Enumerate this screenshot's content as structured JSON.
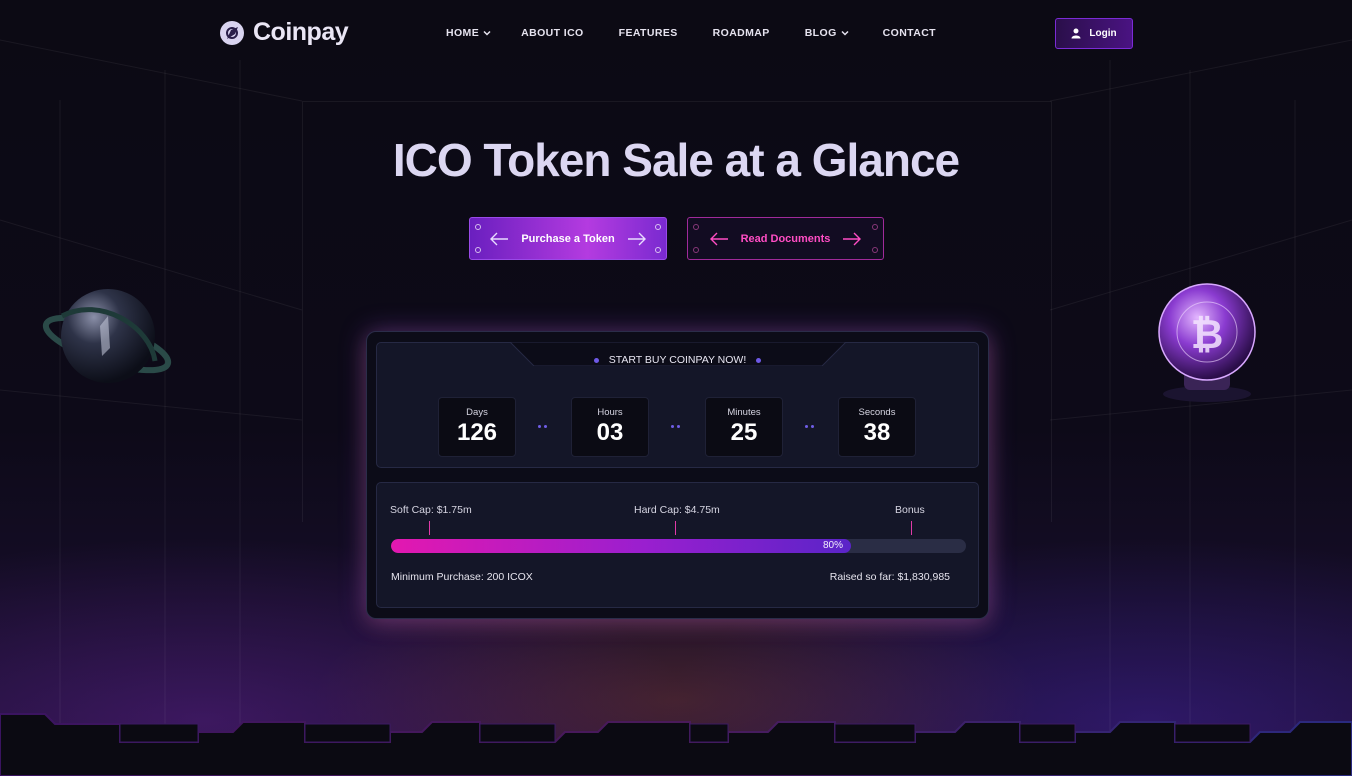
{
  "brand": {
    "name": "Coinpay"
  },
  "nav": {
    "items": [
      {
        "label": "HOME",
        "dropdown": true
      },
      {
        "label": "ABOUT ICO",
        "dropdown": false
      },
      {
        "label": "FEATURES",
        "dropdown": false
      },
      {
        "label": "ROADMAP",
        "dropdown": false
      },
      {
        "label": "BLOG",
        "dropdown": true
      },
      {
        "label": "CONTACT",
        "dropdown": false
      }
    ],
    "login_label": "Login"
  },
  "hero": {
    "title": "ICO Token Sale at a Glance",
    "primary_button": "Purchase a Token",
    "secondary_button": "Read Documents"
  },
  "sale": {
    "tab_label": "START BUY COINPAY NOW!",
    "countdown": [
      {
        "label": "Days",
        "value": "126"
      },
      {
        "label": "Hours",
        "value": "03"
      },
      {
        "label": "Minutes",
        "value": "25"
      },
      {
        "label": "Seconds",
        "value": "38"
      }
    ],
    "soft_cap": "Soft Cap: $1.75m",
    "hard_cap": "Hard Cap: $4.75m",
    "bonus": "Bonus",
    "progress_percent": 80,
    "progress_label": "80%",
    "min_purchase": "Minimum Purchase: 200 ICOX",
    "raised": "Raised so far: $1,830,985"
  },
  "colors": {
    "accent_purple": "#7b2bd6",
    "accent_pink": "#ff4dc4",
    "background": "#0b0914"
  },
  "icons": {
    "login": "user-icon",
    "arrows": [
      "arrow-left-icon",
      "arrow-right-icon"
    ],
    "decor": [
      "planet-icon",
      "bitcoin-globe-icon"
    ]
  }
}
